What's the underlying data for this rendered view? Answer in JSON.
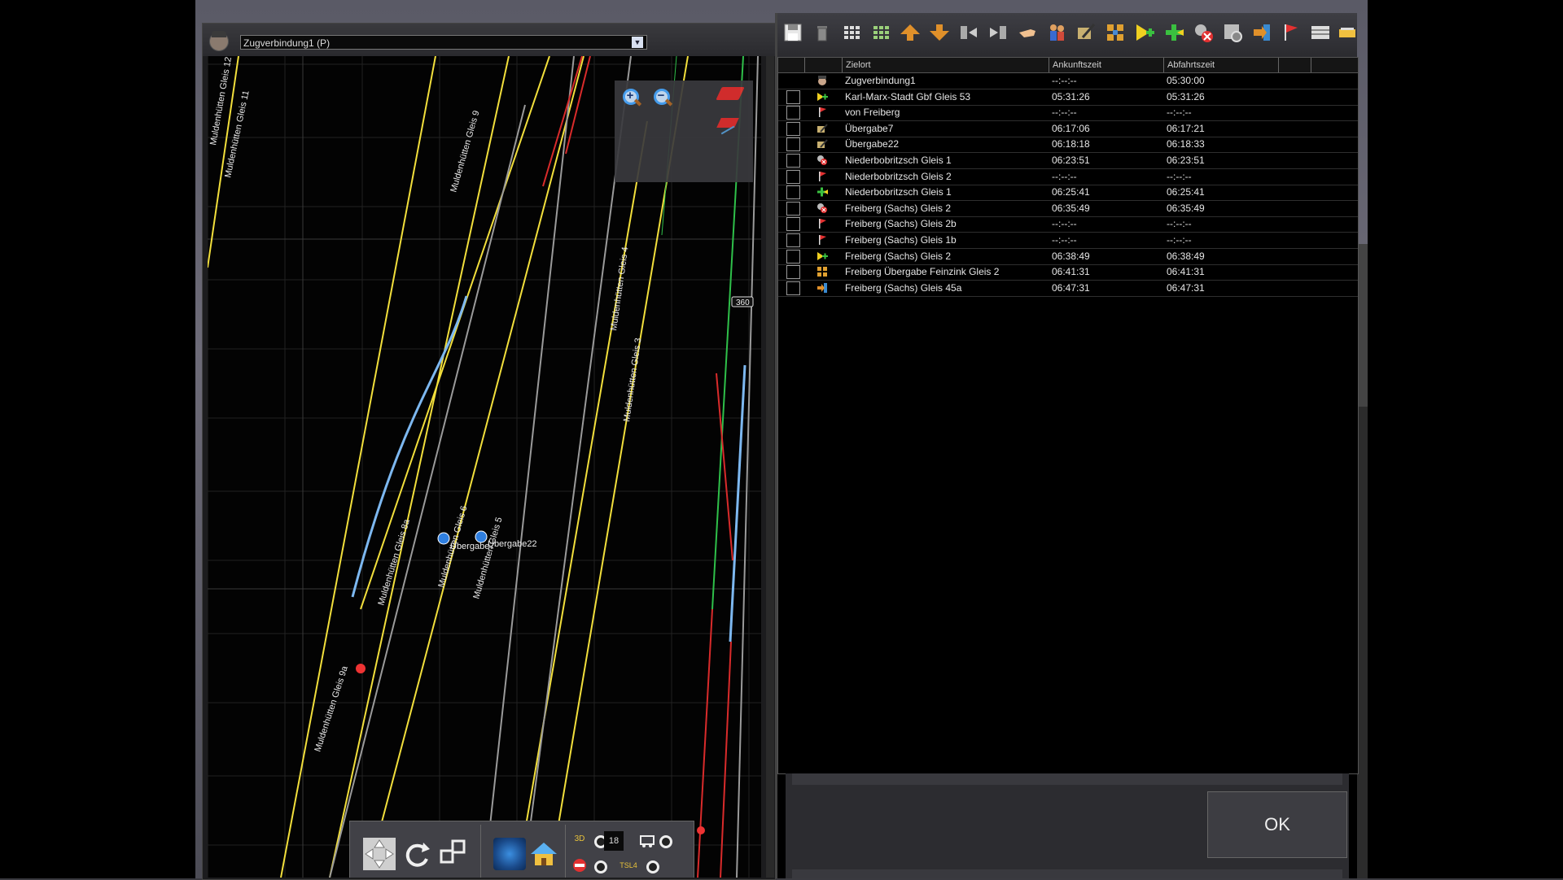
{
  "consist": {
    "selected": "Zugverbindung1 (P)"
  },
  "map": {
    "track_labels": [
      "Muldenhütten Gleis 12",
      "Muldenhütten Gleis 11",
      "Muldenhütten Gleis 9",
      "Muldenhütten Gleis 4",
      "Muldenhütten Gleis 3",
      "Muldenhütten Gleis 8a",
      "Muldenhütten Gleis 6",
      "Muldenhütten Gleis 5",
      "Muldenhütten Gleis 9a"
    ],
    "markers": [
      "Übergabe7",
      "Übergabe22"
    ],
    "distance_sign": "360",
    "height_value": "18",
    "tsl_label": "TSL4"
  },
  "toolbar": {
    "icons": [
      "save-icon",
      "delete-icon",
      "grid-small-icon",
      "grid-green-icon",
      "move-up-icon",
      "move-down-icon",
      "insert-before-icon",
      "insert-after-icon",
      "hand-icon",
      "people-icon",
      "pencil-certificate-icon",
      "merge-icon",
      "add-yellow-icon",
      "add-green-icon",
      "remove-stop-icon",
      "settings-icon",
      "arrow-right-icon",
      "flag-icon",
      "timetable-icon",
      "train-icon"
    ]
  },
  "timetable": {
    "columns": [
      "Zielort",
      "Ankunftszeit",
      "Abfahrtszeit"
    ],
    "rows": [
      {
        "name": "Zugverbindung1",
        "arr": "--:--:--",
        "dep": "05:30:00",
        "icon": "driver-icon",
        "check": false
      },
      {
        "name": "Karl-Marx-Stadt Gbf Gleis 53",
        "arr": "05:31:26",
        "dep": "05:31:26",
        "icon": "add-yellow-icon",
        "check": true
      },
      {
        "name": "von Freiberg",
        "arr": "--:--:--",
        "dep": "--:--:--",
        "icon": "flag-icon",
        "check": true
      },
      {
        "name": "Übergabe7",
        "arr": "06:17:06",
        "dep": "06:17:21",
        "icon": "pencil-certificate-icon",
        "check": true
      },
      {
        "name": "Übergabe22",
        "arr": "06:18:18",
        "dep": "06:18:33",
        "icon": "pencil-certificate-icon",
        "check": true
      },
      {
        "name": "Niederbobritzsch Gleis 1",
        "arr": "06:23:51",
        "dep": "06:23:51",
        "icon": "remove-stop-icon",
        "check": true
      },
      {
        "name": "Niederbobritzsch Gleis 2",
        "arr": "--:--:--",
        "dep": "--:--:--",
        "icon": "flag-icon",
        "check": true
      },
      {
        "name": "Niederbobritzsch Gleis 1",
        "arr": "06:25:41",
        "dep": "06:25:41",
        "icon": "add-green-icon",
        "check": true
      },
      {
        "name": "Freiberg (Sachs) Gleis 2",
        "arr": "06:35:49",
        "dep": "06:35:49",
        "icon": "remove-stop-icon",
        "check": true
      },
      {
        "name": "Freiberg (Sachs) Gleis 2b",
        "arr": "--:--:--",
        "dep": "--:--:--",
        "icon": "flag-icon",
        "check": true
      },
      {
        "name": "Freiberg (Sachs) Gleis 1b",
        "arr": "--:--:--",
        "dep": "--:--:--",
        "icon": "flag-icon",
        "check": true
      },
      {
        "name": "Freiberg (Sachs) Gleis 2",
        "arr": "06:38:49",
        "dep": "06:38:49",
        "icon": "add-yellow-icon",
        "check": true
      },
      {
        "name": "Freiberg Übergabe Feinzink Gleis 2",
        "arr": "06:41:31",
        "dep": "06:41:31",
        "icon": "merge-icon",
        "check": true
      },
      {
        "name": "Freiberg (Sachs) Gleis 45a",
        "arr": "06:47:31",
        "dep": "06:47:31",
        "icon": "arrow-right-icon",
        "check": true
      }
    ]
  },
  "footer": {
    "ok_label": "OK"
  }
}
